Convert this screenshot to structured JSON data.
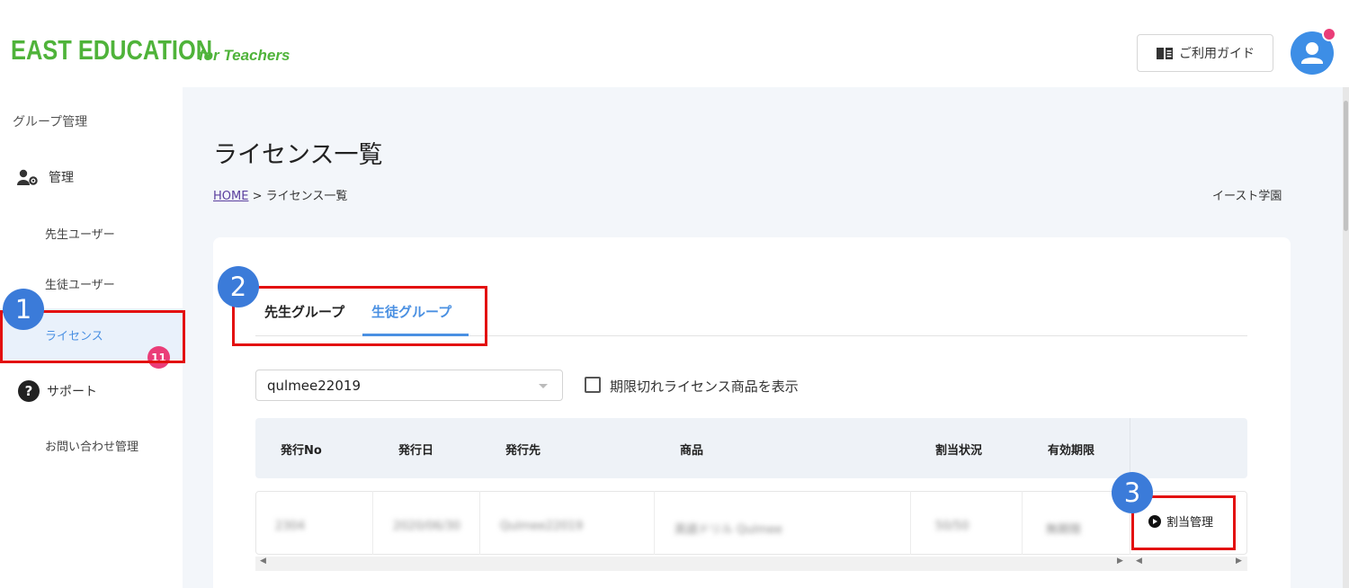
{
  "header": {
    "logo_main": "EAST EDUCATION",
    "logo_sub": "for Teachers",
    "guide_label": "ご利用ガイド",
    "guide_icon": "book-icon",
    "avatar_icon": "user-icon"
  },
  "sidebar": {
    "group_label": "グループ管理",
    "manage_label": "管理",
    "teacher_users": "先生ユーザー",
    "student_users": "生徒ユーザー",
    "license": "ライセンス",
    "support_label": "サポート",
    "inquiries": "お問い合わせ管理",
    "inquiries_badge": "11"
  },
  "main": {
    "title": "ライセンス一覧",
    "breadcrumb_home": "HOME",
    "breadcrumb_sep": ">",
    "breadcrumb_current": "ライセンス一覧",
    "school_name": "イースト学園"
  },
  "tabs": [
    {
      "label": "先生グループ",
      "active": false
    },
    {
      "label": "生徒グループ",
      "active": true
    }
  ],
  "filter": {
    "group_select_value": "qulmee22019",
    "show_expired_label": "期限切れライセンス商品を表示",
    "show_expired_checked": false
  },
  "table": {
    "headers": [
      "発行No",
      "発行日",
      "発行先",
      "商品",
      "割当状況",
      "有効期限"
    ],
    "row_blurred": [
      "2304",
      "2020/06/30",
      "Qulmee22019",
      "英語ドリル Qulmee",
      "50/50",
      "無期限"
    ],
    "assign_label": "割当管理"
  },
  "annotations": [
    "1",
    "2",
    "3"
  ],
  "colors": {
    "brand_green": "#4fb33a",
    "accent_blue": "#4a90e2",
    "badge_pink": "#ea3d78",
    "annotation_red": "#e31010",
    "step_blue": "#3b7bd9"
  }
}
